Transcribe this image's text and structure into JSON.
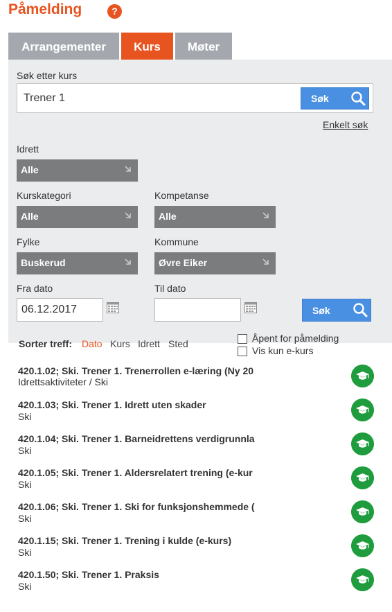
{
  "header": {
    "title": "Påmelding",
    "help_glyph": "?"
  },
  "tabs": [
    {
      "label": "Arrangementer"
    },
    {
      "label": "Kurs"
    },
    {
      "label": "Møter"
    }
  ],
  "search": {
    "label": "Søk etter kurs",
    "value": "Trener 1",
    "button": "Søk",
    "simple_link": "Enkelt søk"
  },
  "filters": {
    "idrett": {
      "label": "Idrett",
      "value": "Alle"
    },
    "kurskategori": {
      "label": "Kurskategori",
      "value": "Alle"
    },
    "kompetanse": {
      "label": "Kompetanse",
      "value": "Alle"
    },
    "fylke": {
      "label": "Fylke",
      "value": "Buskerud"
    },
    "kommune": {
      "label": "Kommune",
      "value": "Øvre Eiker"
    },
    "fra_dato": {
      "label": "Fra dato",
      "value": "06.12.2017"
    },
    "til_dato": {
      "label": "Til dato",
      "value": ""
    },
    "button": "Søk"
  },
  "sort": {
    "label": "Sorter treff:",
    "options": [
      "Dato",
      "Kurs",
      "Idrett",
      "Sted"
    ],
    "active": "Dato"
  },
  "checkboxes": [
    {
      "label": "Åpent for påmelding",
      "checked": false
    },
    {
      "label": "Vis kun e-kurs",
      "checked": false
    }
  ],
  "courses": [
    {
      "title": "420.1.02; Ski. Trener 1. Trenerrollen e-læring (Ny 20",
      "subtitle": "Idrettsaktiviteter / Ski"
    },
    {
      "title": "420.1.03; Ski. Trener 1. Idrett uten skader",
      "subtitle": "Ski"
    },
    {
      "title": "420.1.04; Ski. Trener 1. Barneidrettens verdigrunnla",
      "subtitle": "Ski"
    },
    {
      "title": "420.1.05; Ski. Trener 1. Aldersrelatert trening (e-kur",
      "subtitle": "Ski"
    },
    {
      "title": "420.1.06; Ski. Trener 1. Ski for funksjonshemmede (",
      "subtitle": "Ski"
    },
    {
      "title": "420.1.15; Ski. Trener 1. Trening i kulde (e-kurs)",
      "subtitle": "Ski"
    },
    {
      "title": "420.1.50; Ski. Trener 1. Praksis",
      "subtitle": "Ski"
    }
  ],
  "colors": {
    "accent": "#e8541f",
    "tab_inactive": "#a4a8ae",
    "search_button": "#4a90e2",
    "dropdown": "#7b7c7e",
    "course_icon": "#1f9c3d"
  },
  "icons": {
    "help": "question-mark-icon",
    "search": "magnifier-icon",
    "dropdown": "arrow-down-right-icon",
    "calendar": "calendar-icon",
    "course": "graduation-cap-icon"
  }
}
